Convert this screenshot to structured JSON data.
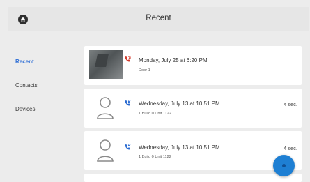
{
  "header": {
    "title": "Recent"
  },
  "sidebar": {
    "items": [
      {
        "label": "Recent"
      },
      {
        "label": "Contacts"
      },
      {
        "label": "Devices"
      }
    ]
  },
  "calls": [
    {
      "title": "Monday, July 25 at 6:20 PM",
      "subtitle": "Door 1",
      "duration": ""
    },
    {
      "title": "Wednesday, July 13 at 10:51 PM",
      "subtitle": "1 Build 0 Unit 1122",
      "duration": "4 sec."
    },
    {
      "title": "Wednesday, July 13 at 10:51 PM",
      "subtitle": "1 Build 0 Unit 1122",
      "duration": "4 sec."
    }
  ],
  "icons": {
    "home": "home-icon",
    "missed_call": "missed-call-icon",
    "incoming_call": "incoming-call-icon",
    "avatar": "person-icon"
  },
  "colors": {
    "accent": "#2f6fd6",
    "missed_call": "#d33a2c",
    "incoming_call": "#2a6bd1",
    "fab": "#1e7fd3"
  }
}
